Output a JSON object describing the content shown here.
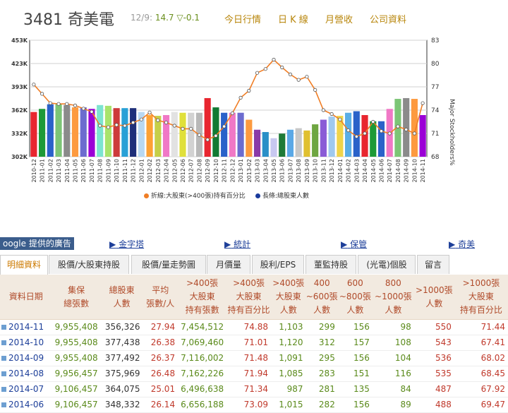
{
  "header": {
    "code": "3481",
    "name": "奇美電",
    "quote_date": "12/9:",
    "price": "14.7",
    "change": "▽-0.1",
    "nav": [
      "今日行情",
      "日 K 線",
      "月營收",
      "公司資料"
    ]
  },
  "chart_data": {
    "type": "bar",
    "categories": [
      "2010-12",
      "2011-01",
      "2011-02",
      "2011-03",
      "2011-04",
      "2011-05",
      "2011-06",
      "2011-07",
      "2011-08",
      "2011-09",
      "2011-10",
      "2011-11",
      "2011-12",
      "2012-01",
      "2012-02",
      "2012-03",
      "2012-04",
      "2012-05",
      "2012-06",
      "2012-07",
      "2012-08",
      "2012-09",
      "2012-10",
      "2012-11",
      "2012-12",
      "2013-01",
      "2013-02",
      "2013-03",
      "2013-04",
      "2013-05",
      "2013-06",
      "2013-07",
      "2013-08",
      "2013-09",
      "2013-10",
      "2013-11",
      "2013-12",
      "2014-01",
      "2014-02",
      "2014-03",
      "2014-04",
      "2014-05",
      "2014-06",
      "2014-07",
      "2014-08",
      "2014-09",
      "2014-10",
      "2014-11"
    ],
    "yticks_left": [
      "453K",
      "423K",
      "393K",
      "362K",
      "332K",
      "302K"
    ],
    "yticks_right": [
      "83",
      "80",
      "77",
      "74",
      "71",
      "68"
    ],
    "ylabel_right": "Major Stockholders%",
    "ylim_left": [
      302,
      453
    ],
    "ylim_right": [
      68,
      83
    ],
    "series": [
      {
        "name": "長條:總股東人數",
        "axis": "left",
        "color": "#1a3b9c",
        "values": [
          360,
          364,
          370,
          370,
          369,
          366,
          366,
          364,
          369,
          368,
          365,
          365,
          365,
          360,
          356,
          355,
          356,
          360,
          359,
          359,
          359,
          378,
          366,
          359,
          359,
          359,
          350,
          337,
          334,
          326,
          332,
          337,
          339,
          336,
          344,
          350,
          354,
          355,
          359,
          361,
          356,
          348,
          348,
          364,
          377,
          378,
          377,
          356
        ]
      },
      {
        "name": "折線:大股東(>400張)持有百分比",
        "axis": "right",
        "type": "line",
        "color": "#f07e26",
        "values": [
          77.3,
          76.1,
          74.9,
          74.8,
          74.8,
          74.6,
          74.2,
          73.8,
          72.0,
          71.8,
          72.1,
          72.0,
          72.4,
          72.8,
          73.7,
          72.7,
          72.4,
          72.0,
          71.6,
          71.6,
          70.8,
          70.2,
          70.7,
          71.9,
          73.6,
          75.6,
          76.5,
          78.8,
          79.3,
          80.5,
          79.5,
          78.6,
          77.9,
          78.3,
          76.6,
          74.0,
          73.5,
          72.8,
          71.4,
          70.6,
          71.0,
          72.5,
          71.3,
          71.0,
          71.9,
          71.5,
          71.0,
          74.9
        ]
      }
    ],
    "bar_colors": [
      "#e8262f",
      "#1e9a37",
      "#2a62c9",
      "#7cc576",
      "#8b8b8b",
      "#fd9a3f",
      "#6c6ccf",
      "#9b00d6",
      "#7ce4d0",
      "#a8e36b",
      "#cd3b3b",
      "#28a0d6",
      "#1f2f7a",
      "#b8d8f2",
      "#fda134",
      "#c6cf48",
      "#f078c6",
      "#e2e2e2",
      "#e0e03a",
      "#d2d2d2",
      "#b8b8b8",
      "#e8262f",
      "#117a33",
      "#2a62c9",
      "#f078c6",
      "#6c6ccf",
      "#fd9a3f",
      "#8a3aa8",
      "#2a8fc7",
      "#c8c8f0",
      "#1e7a37",
      "#5aa8e6",
      "#c8c8c8",
      "#e0c030",
      "#6fa641",
      "#8a5bd6",
      "#9fc9ef",
      "#f0d44a",
      "#5aaee6",
      "#2a62c9",
      "#e8262f",
      "#1e9a37",
      "#2a62c9",
      "#f078c6",
      "#7cc576",
      "#8b8b8b",
      "#fd9a3f",
      "#9b00d6"
    ],
    "grid": true
  },
  "ads": {
    "label": "oogle 提供的廣告",
    "links": [
      "金字塔",
      "統計",
      "保管",
      "奇美"
    ]
  },
  "tabs": [
    "明細資料",
    "股價/大股東持股",
    "股價/量走勢圖",
    "月價量",
    "股利/EPS",
    "董監持股",
    "(光電)個股",
    "留言"
  ],
  "table": {
    "headers": [
      [
        "資料日期"
      ],
      [
        "集保",
        "總張數"
      ],
      [
        "總股東",
        "人數"
      ],
      [
        "平均",
        "張數/人"
      ],
      [
        ">400張",
        "大股東",
        "持有張數"
      ],
      [
        ">400張",
        "大股東",
        "持有百分比"
      ],
      [
        ">400張",
        "大股東",
        "人數"
      ],
      [
        "400",
        "~600張",
        "人數"
      ],
      [
        "600",
        "~800張",
        "人數"
      ],
      [
        "800",
        "~1000張",
        "人數"
      ],
      [
        ">1000張",
        "人數"
      ],
      [
        ">1000張",
        "大股東",
        "持有百分比"
      ]
    ],
    "rows": [
      [
        "2014-11",
        "9,955,408",
        "356,326",
        "27.94",
        "7,454,512",
        "74.88",
        "1,103",
        "299",
        "156",
        "98",
        "550",
        "71.44"
      ],
      [
        "2014-10",
        "9,955,408",
        "377,438",
        "26.38",
        "7,069,460",
        "71.01",
        "1,120",
        "312",
        "157",
        "108",
        "543",
        "67.41"
      ],
      [
        "2014-09",
        "9,955,408",
        "377,492",
        "26.37",
        "7,116,002",
        "71.48",
        "1,091",
        "295",
        "156",
        "104",
        "536",
        "68.02"
      ],
      [
        "2014-08",
        "9,956,457",
        "375,969",
        "26.48",
        "7,162,226",
        "71.94",
        "1,085",
        "283",
        "151",
        "116",
        "535",
        "68.45"
      ],
      [
        "2014-07",
        "9,106,457",
        "364,075",
        "25.01",
        "6,496,638",
        "71.34",
        "987",
        "281",
        "135",
        "84",
        "487",
        "67.92"
      ],
      [
        "2014-06",
        "9,106,457",
        "348,332",
        "26.14",
        "6,656,188",
        "73.09",
        "1,015",
        "282",
        "156",
        "89",
        "488",
        "69.47"
      ]
    ]
  }
}
